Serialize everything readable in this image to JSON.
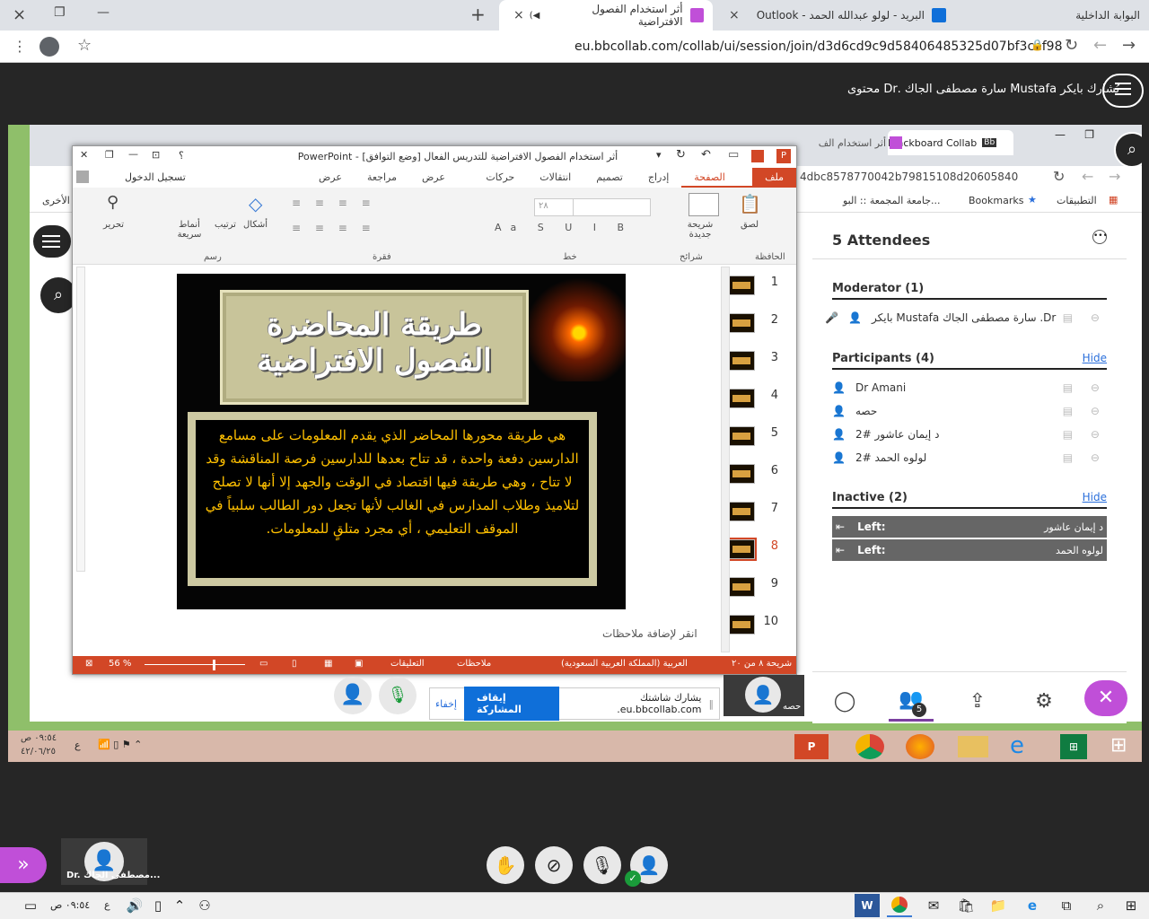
{
  "browser": {
    "tabs": [
      {
        "label": "البوابة الداخلية",
        "close": "×"
      },
      {
        "label": "البريد - لولو عبدالله الحمد - Outlook",
        "close": "×"
      },
      {
        "label": "أثر استخدام الفصول الافتراضية",
        "close": "×",
        "active": true
      }
    ],
    "new_tab": "+",
    "window_controls": {
      "close": "×",
      "restore": "❐",
      "minimize": "—"
    },
    "url": "eu.bbcollab.com/collab/ui/session/join/d3d6cd9c9d58406485325d07bf3cef98"
  },
  "collab_header": {
    "menu_icon": "hamburger-icon",
    "sharing_text": "يُشارك بايكر Mustafa سارة مصطفى الجاك .Dr محتوى"
  },
  "shared_browser": {
    "tabs": [
      {
        "label": "Blackboard Collab"
      },
      {
        "label": "أثر استخدام الف"
      }
    ],
    "url": "4dbc8578770042b79815108d20605840",
    "bookmarks": [
      "التطبيقات",
      "Bookmarks",
      "جامعة المجمعة :: البو..."
    ],
    "other_bookmarks": "الأخرى"
  },
  "ppt": {
    "title": "أثر استخدام الفصول الافتراضية للتدريس الفعال [وضع التوافق] - PowerPoint",
    "signin": "تسجيل الدخول",
    "help": "؟",
    "tabs": [
      "ملف",
      "الصفحة الرئيسية",
      "إدراج",
      "تصميم",
      "انتقالات",
      "حركات",
      "عرض الشرائح",
      "مراجعة",
      "عرض"
    ],
    "groups": {
      "clipboard": "الحافظة",
      "slides": "شرائح",
      "font": "خط",
      "paragraph": "فقرة",
      "drawing": "رسم",
      "editing": "تحرير"
    },
    "buttons": {
      "paste": "لصق",
      "new_slide": "شريحة جديدة",
      "shapes": "أشكال",
      "arrange": "ترتيب",
      "quick_styles": "أنماط سريعة",
      "find": "تحرير"
    },
    "font_size": "٢٨",
    "slide": {
      "title_line1": "طريقة المحاضرة",
      "title_line2": "الفصول الافتراضية",
      "body": "هي طريقة محورها المحاضر الذي يقدم المعلومات على مسامع الدارسين دفعة واحدة ، قد تتاح بعدها للدارسين فرصة المناقشة وقد لا تتاح ، وهي طريقة فيها اقتصاد في الوقت والجهد إلا أنها لا تصلح لتلاميذ وطلاب المدارس في الغالب لأنها تجعل دور الطالب سلبياً في الموقف التعليمي ، أي مجرد متلقٍ للمعلومات."
    },
    "notes_placeholder": "انقر لإضافة ملاحظات",
    "thumbnails": [
      "1",
      "2",
      "3",
      "4",
      "5",
      "6",
      "7",
      "8",
      "9",
      "10"
    ],
    "selected_slide": "8",
    "status": {
      "slide_of": "شريحة ٨ من ٢٠",
      "language": "العربية (المملكة العربية السعودية)",
      "notes": "ملاحظات",
      "comments": "التعليقات",
      "zoom": "56 %"
    }
  },
  "share_bar": {
    "text": "يشارك شاشتك eu.bbcollab.com.",
    "stop": "إيقاف المشاركة",
    "hide": "إخفاء"
  },
  "attendees": {
    "header": "5 Attendees",
    "moderator_title": "Moderator (1)",
    "moderator": "بايكر Mustafa سارة مصطفى الجاك .Dr",
    "participants_title": "Participants (4)",
    "participants": [
      "Dr Amani",
      "حصه",
      "د إيمان عاشور #2",
      "لولوه الحمد #2"
    ],
    "hide": "Hide",
    "inactive_title": "Inactive (2)",
    "inactive": [
      {
        "status": "Left:",
        "name": "د إيمان عاشور"
      },
      {
        "status": "Left:",
        "name": "لولوه الحمد"
      }
    ],
    "badge_count": "5"
  },
  "video_tiles": {
    "hessa": "حصه",
    "presenter": "Dr. مصطفى الجاك..."
  },
  "inner_taskbar": {
    "time": "٠٩:٥٤ ص",
    "date": "٤٢/٠٦/٢٥",
    "lang": "ع"
  },
  "windows_taskbar": {
    "time": "٠٩:٥٤ ص",
    "lang": "ع"
  },
  "colors": {
    "ppt_accent": "#d24726",
    "bb_purple": "#c04fd8",
    "share_green": "#8fbf6a",
    "stop_blue": "#0f6fd9"
  }
}
